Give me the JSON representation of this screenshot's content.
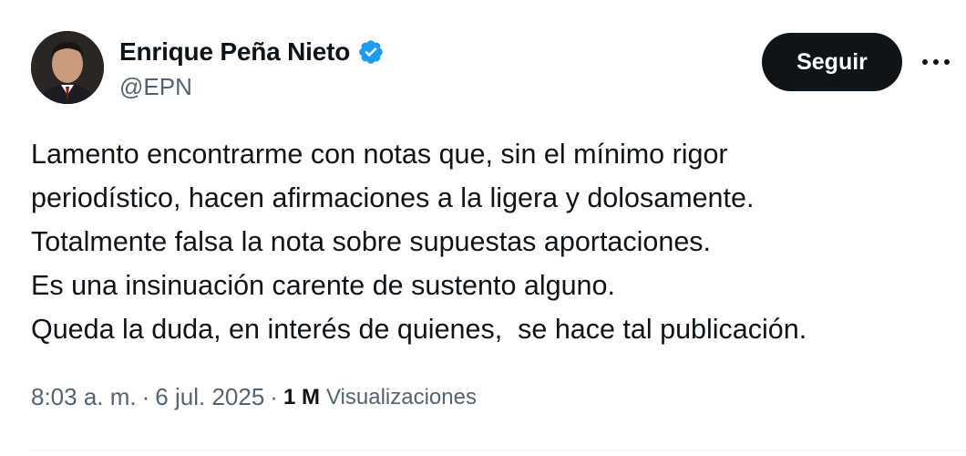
{
  "author": {
    "name": "Enrique Peña Nieto",
    "handle": "@EPN",
    "verified": true,
    "verified_color": "#1d9bf0"
  },
  "actions": {
    "follow_label": "Seguir",
    "more_icon": "more-dots-icon"
  },
  "tweet": {
    "lines": [
      "Lamento encontrarme con notas que, sin el mínimo rigor",
      "periodístico, hacen afirmaciones a la ligera y dolosamente.",
      "Totalmente falsa la nota sobre supuestas aportaciones.",
      "Es una insinuación carente de sustento alguno.",
      "Queda la duda, en interés de quienes,  se hace tal publicación."
    ]
  },
  "meta": {
    "time": "8:03 a. m.",
    "separator": "·",
    "date": "6 jul. 2025",
    "views_count": "1 M",
    "views_label": "Visualizaciones"
  },
  "colors": {
    "text": "#0f1419",
    "secondary": "#536471",
    "button_bg": "#0f1419",
    "button_text": "#ffffff"
  }
}
